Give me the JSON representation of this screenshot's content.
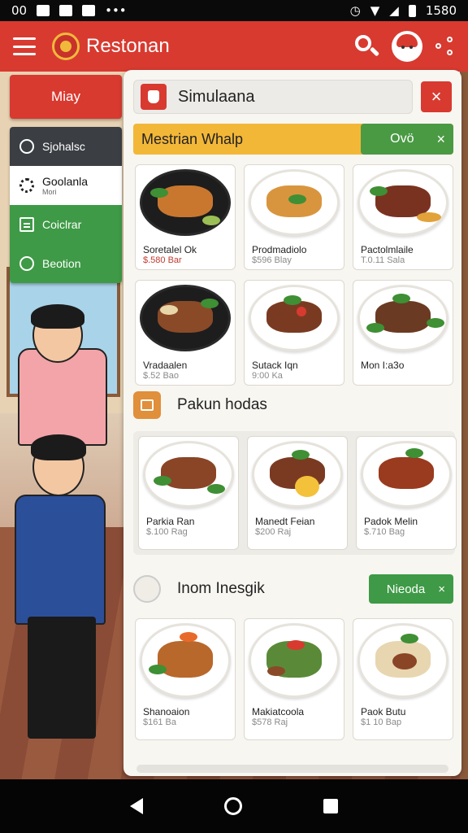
{
  "status_bar": {
    "left_text": "00",
    "time": "1580",
    "icons": [
      "image-icon",
      "photo-icon",
      "app-icon",
      "more-icon",
      "alarm-icon",
      "wifi-icon",
      "signal-icon",
      "battery-icon"
    ]
  },
  "app_bar": {
    "title": "Restonan",
    "icons": [
      "menu-icon",
      "logo-icon",
      "search-icon",
      "avatar-icon",
      "share-icon"
    ],
    "color": "#d83a30"
  },
  "drawer": {
    "header": "Miay",
    "items": [
      {
        "label": "Sjohalsc",
        "sub": ""
      },
      {
        "label": "Goolanla",
        "sub": "Mori"
      },
      {
        "label": "Coiclrar",
        "sub": ""
      },
      {
        "label": "Beotion",
        "sub": ""
      }
    ]
  },
  "search": {
    "value": "Simulaana",
    "close": "×"
  },
  "banner": {
    "title": "Mestrian Whalp",
    "chip_label": "Ovö",
    "chip_close": "×",
    "color": "#f3b738"
  },
  "section1": {
    "cards": [
      {
        "name": "Soretalel Ok",
        "price": "$.580 Bar"
      },
      {
        "name": "Prodmadiolo",
        "price": "$596 Blay"
      },
      {
        "name": "Pactolmlaile",
        "price": "T.0.11 Sala"
      },
      {
        "name": "Vradaalen",
        "price": "$.52 Bao"
      },
      {
        "name": "Sutack Iqn",
        "price": "9:00 Ka"
      },
      {
        "name": "Mon I:a3o",
        "price": ""
      }
    ]
  },
  "section2": {
    "title": "Pakun hodas",
    "cards": [
      {
        "name": "Parkia Ran",
        "price": "$.100 Rag"
      },
      {
        "name": "Manedt Feian",
        "price": "$200 Raj"
      },
      {
        "name": "Padok Melin",
        "price": "$.710 Bag"
      }
    ]
  },
  "section3": {
    "title": "Inom Inesgik",
    "chip_label": "Nieoda",
    "chip_close": "×",
    "cards": [
      {
        "name": "Shanoaion",
        "price": "$161 Ba"
      },
      {
        "name": "Makiatcoola",
        "price": "$578 Raj"
      },
      {
        "name": "Paok Butu",
        "price": "$1 10 Bap"
      }
    ]
  },
  "nav_bar": {
    "icons": [
      "back-icon",
      "home-icon",
      "recents-icon"
    ]
  }
}
